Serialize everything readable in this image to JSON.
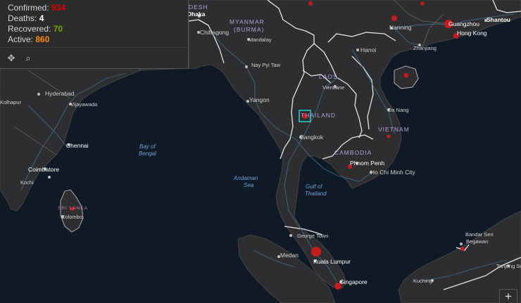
{
  "colors": {
    "sea": "#0f1a26",
    "land": "#2e2e30",
    "border": "#e6e6e6",
    "road": "#3d6f95",
    "case_marker": "#d7191c",
    "selection": "#29c7c7",
    "confirmed": "#e60000",
    "deaths": "#ffffff",
    "recovered": "#70a800",
    "active": "#ff8c00"
  },
  "stats": {
    "confirmed_label": "Confirmed:",
    "confirmed_value": "934",
    "deaths_label": "Deaths:",
    "deaths_value": "4",
    "recovered_label": "Recovered:",
    "recovered_value": "70",
    "active_label": "Active:",
    "active_value": "860"
  },
  "panel_tools": [
    {
      "name": "pan-icon",
      "glyph": "✥"
    },
    {
      "name": "zoom-search-icon",
      "glyph": "⌕"
    }
  ],
  "zoom_in_label": "+",
  "labels": {
    "countries": {
      "bangladesh": "DESH",
      "myanmar_1": "MYANMAR",
      "myanmar_2": "(BURMA)",
      "laos": "LAOS",
      "thailand": "THAILAND",
      "vietnam": "VIETNAM",
      "cambodia": "CAMBODIA",
      "sri_lanka": "SRI LANKA"
    },
    "cities": {
      "dhaka": "Dhaka",
      "chittagong": "Chittagong",
      "mandalay": "Mandalay",
      "nay_pyi_taw": "Nay Pyi Taw",
      "yangon": "Yangon",
      "hanoi": "Hanoi",
      "nanning": "Nanning",
      "guangzhou": "Guangzhou",
      "shantou": "Shantou",
      "hong_kong": "Hong Kong",
      "zhanjiang": "Zhanjiang",
      "vientiane": "Vientiane",
      "da_nang": "Da Nang",
      "bangkok": "Bangkok",
      "phnom_penh": "Phnom Penh",
      "ho_chi_minh": "Ho Chi Minh City",
      "hyderabad": "Hyderabad",
      "kolhapur": "Kolhapur",
      "vijayawada": "Vijayawada",
      "chennai": "Chennai",
      "coimbatore": "Coimbatore",
      "kochi": "Kochi",
      "colombo": "Colombo",
      "george_town": "George Town",
      "medan": "Medan",
      "kuala_lumpur": "Kuala Lumpur",
      "singapore": "Singapore",
      "bandar_1": "Bandar Seri",
      "bandar_2": "Begawan",
      "tanjung": "Tanjung Se",
      "kuching": "Kuching"
    },
    "water": {
      "bay_1": "Bay of",
      "bay_2": "Bengal",
      "andaman_1": "Andaman",
      "andaman_2": "Sea",
      "gulf_1": "Gulf of",
      "gulf_2": "Thailand"
    }
  },
  "markers": [
    {
      "name": "marker-thailand",
      "location": "Thailand",
      "size": "medium"
    },
    {
      "name": "marker-kuala-lumpur",
      "location": "Kuala Lumpur",
      "size": "large"
    },
    {
      "name": "marker-singapore",
      "location": "Singapore",
      "size": "medium"
    },
    {
      "name": "marker-phnom-penh",
      "location": "Phnom Penh",
      "size": "small"
    },
    {
      "name": "marker-vietnam",
      "location": "Vietnam",
      "size": "small"
    },
    {
      "name": "marker-sri-lanka",
      "location": "Sri Lanka",
      "size": "small"
    },
    {
      "name": "marker-guangzhou",
      "location": "Guangzhou",
      "size": "large"
    },
    {
      "name": "marker-hong-kong",
      "location": "Hong Kong",
      "size": "medium"
    },
    {
      "name": "marker-nanning",
      "location": "Nanning",
      "size": "small"
    },
    {
      "name": "marker-hainan",
      "location": "Hainan",
      "size": "small"
    },
    {
      "name": "marker-brunei",
      "location": "Brunei",
      "size": "small"
    },
    {
      "name": "marker-yunnan",
      "location": "Yunnan",
      "size": "small"
    },
    {
      "name": "marker-guangxi-north",
      "location": "Guangxi",
      "size": "small"
    }
  ]
}
